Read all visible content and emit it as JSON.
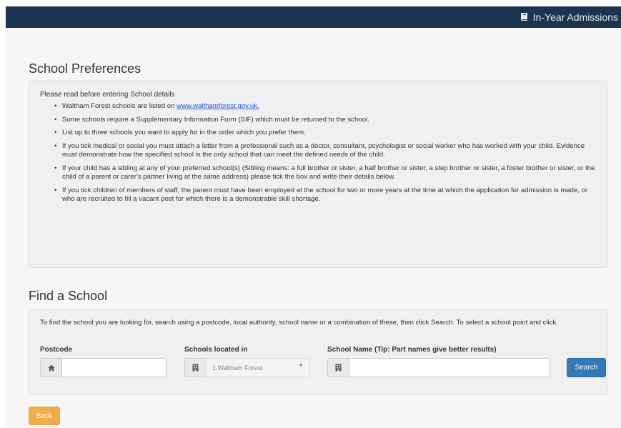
{
  "navbar": {
    "title": "In-Year Admissions",
    "icon": "book-icon",
    "background": "#1b3450"
  },
  "preferences": {
    "heading": "School Preferences",
    "intro": "Please read before entering School details",
    "bullets": [
      {
        "prefix": "Waltham Forest schools are listed on ",
        "link": "www.walthamforest.gov.uk."
      },
      {
        "text": "Some schools require a Supplementary Information Form (SIF) which must be returned to the school."
      },
      {
        "text": "List up to three schools you want to apply for in the order which you prefer them."
      },
      {
        "text": "If you tick medical or social you must attach a letter from a professional such as a doctor, consultant, psychologist or social worker who has worked with your child. Evidence must demonstrate how the specified school is the only school that can meet the defined needs of the child."
      },
      {
        "text": "If your child has a sibling at any of your preferred school(s) (Sibling means: a full brother or sister, a half brother or sister, a step brother or sister, a foster brother or sister, or the child of a parent or carer's partner living at the same address) please tick the box and write their details below."
      },
      {
        "text": "If you tick children of members of staff, the parent must have been employed at the school for two or more years at the time at which the application for admission is made, or who are recruited to fill a vacant post for which there is a demonstrable skill shortage."
      }
    ]
  },
  "find": {
    "heading": "Find a School",
    "intro": "To find the school you are looking for, search using a postcode, local authority, school name or a combination of these, then click Search. To select a school point and click.",
    "postcode": {
      "label": "Postcode",
      "value": "",
      "placeholder": "",
      "icon": "home-icon"
    },
    "located_in": {
      "label": "Schools located in",
      "selected": "1.Waltham Forest",
      "icon": "building-icon"
    },
    "school_name": {
      "label": "School Name (Tip: Part names give better results)",
      "value": "",
      "placeholder": "",
      "icon": "building-icon"
    },
    "search_label": "Search",
    "search_color": "#337ab7"
  },
  "back_label": "Back",
  "back_color": "#f0ad4e"
}
